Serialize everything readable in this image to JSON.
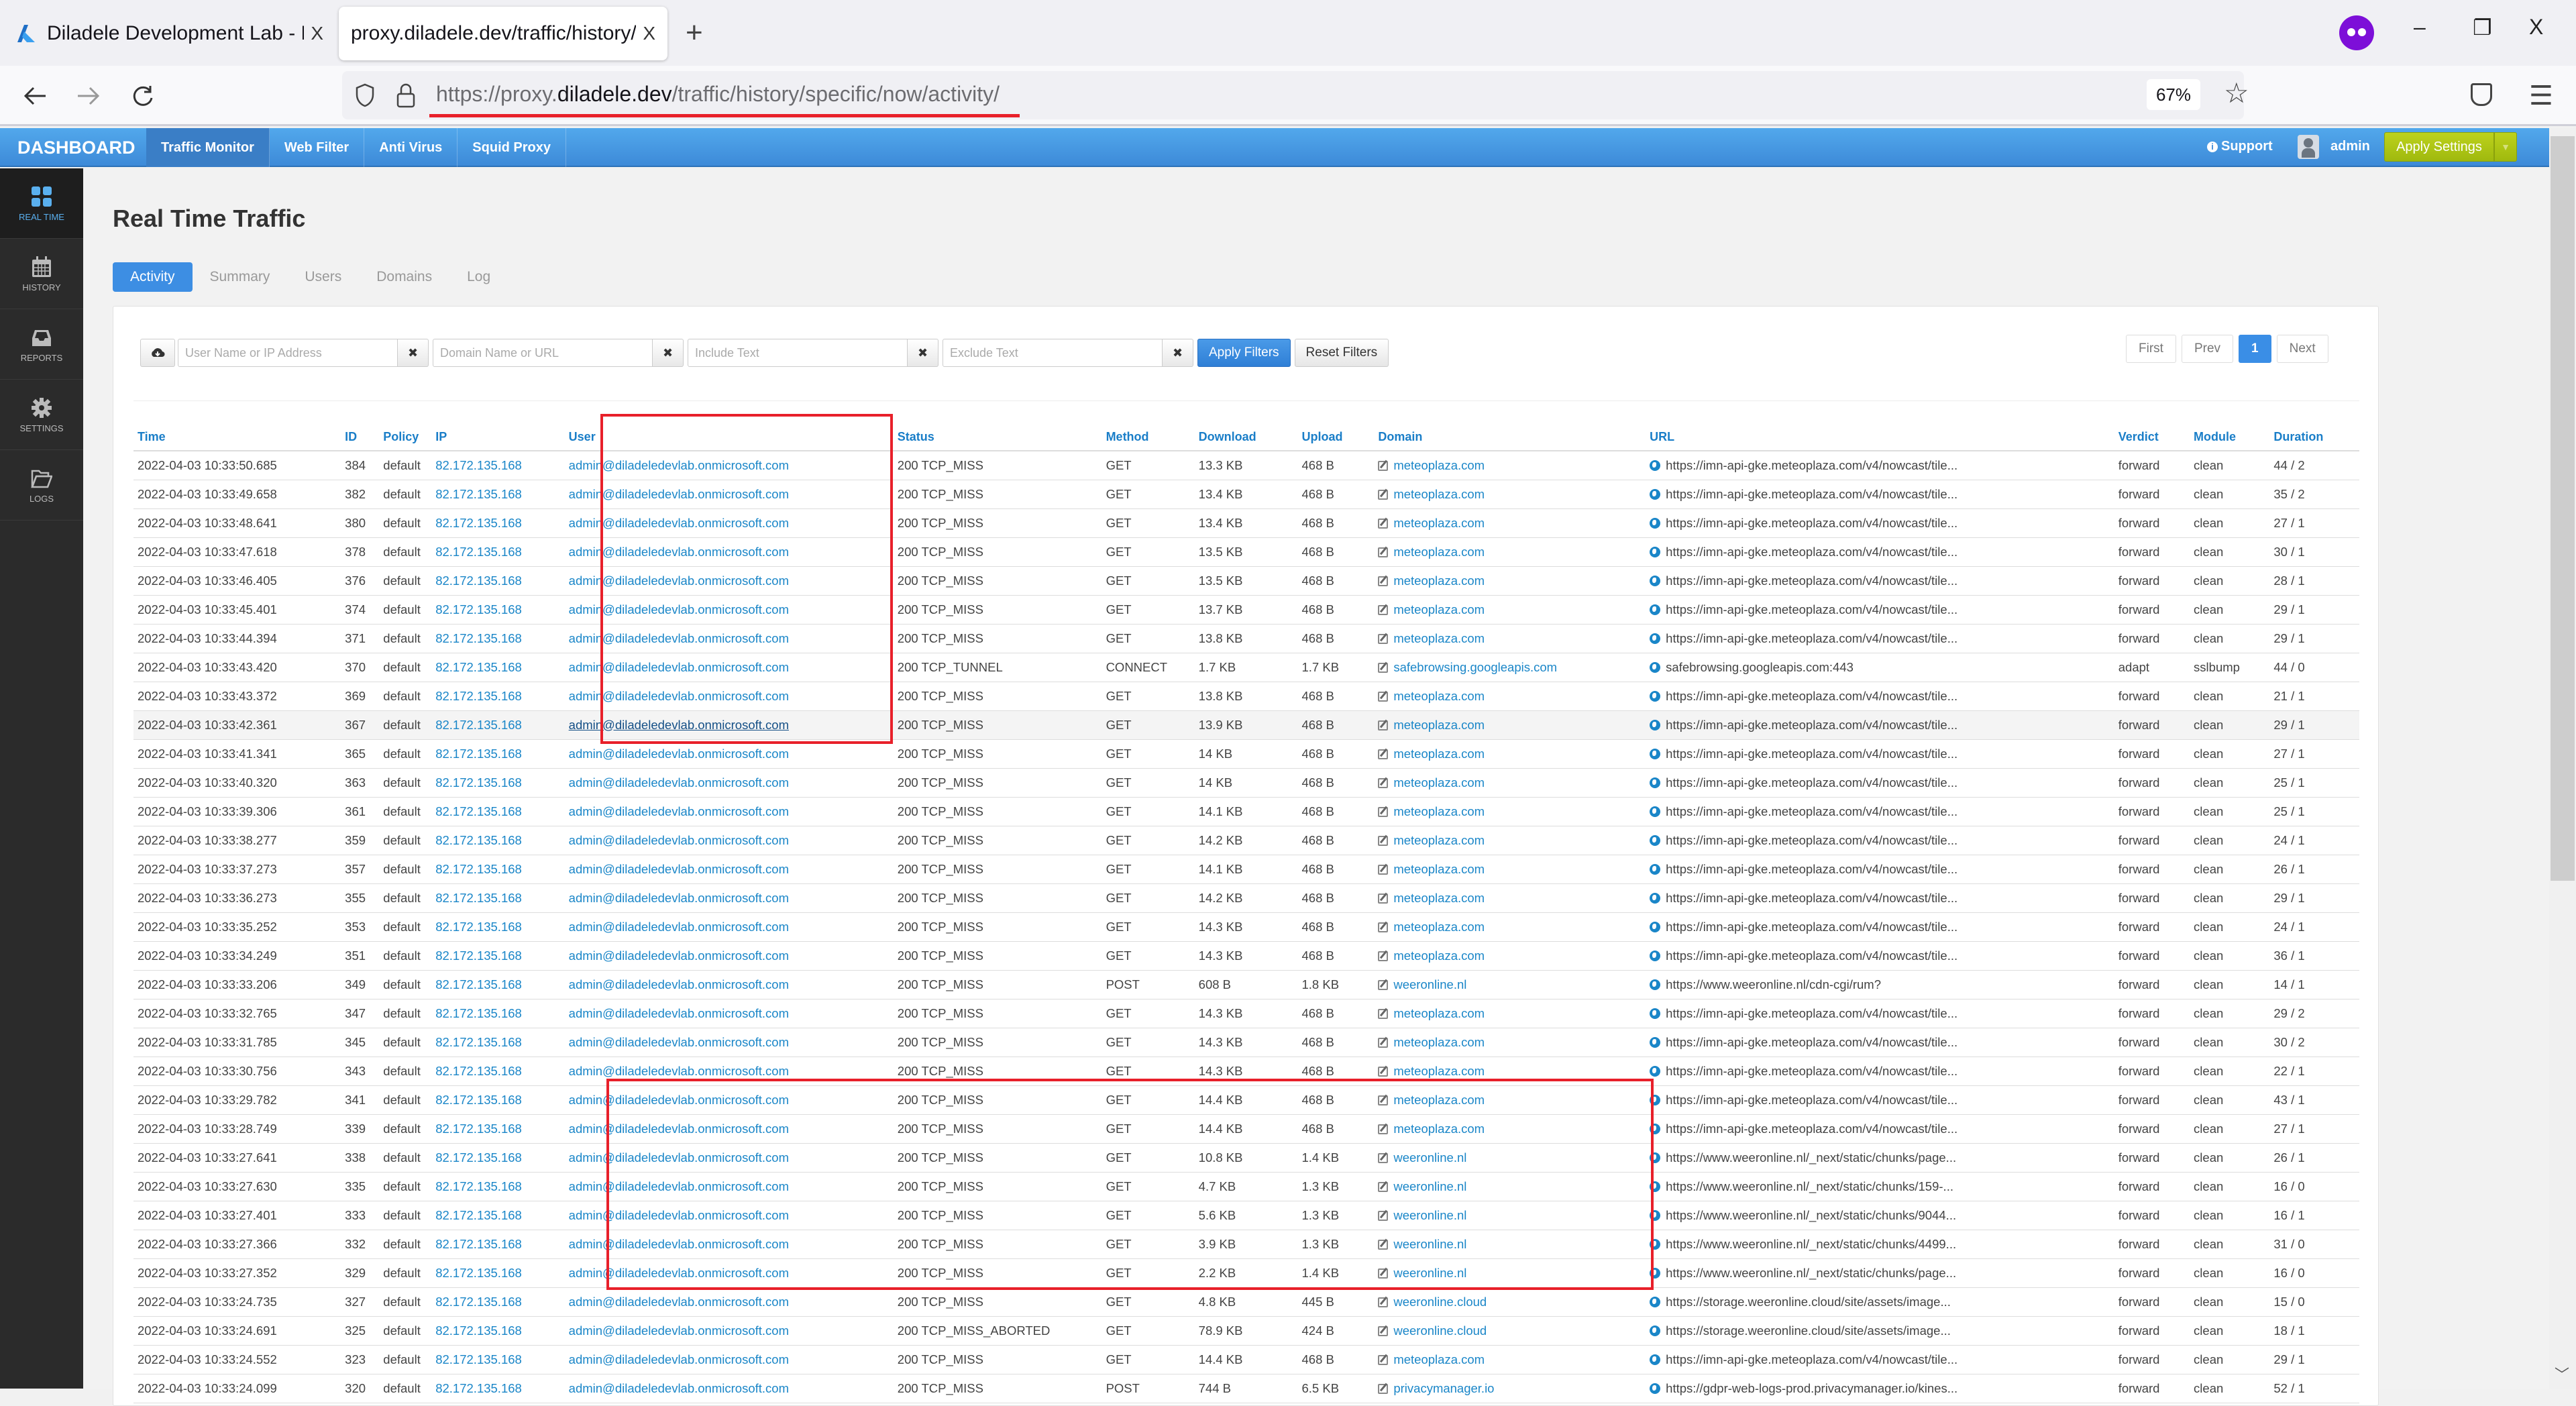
{
  "browser": {
    "tabs": [
      {
        "title": "Diladele Development Lab - Mic",
        "icon": "azure-logo-icon",
        "active": false
      },
      {
        "title": "proxy.diladele.dev/traffic/history/spe",
        "active": true
      }
    ],
    "close_glyph": "X",
    "new_tab_glyph": "+",
    "url_prefix": "https://proxy.",
    "url_domain": "diladele.dev",
    "url_path": "/traffic/history/specific/now/activity/",
    "zoom_level": "67%",
    "window_controls": {
      "minimize": "–",
      "restore": "❐",
      "close": "X"
    }
  },
  "app": {
    "brand": "DASHBOARD",
    "nav": [
      {
        "label": "Traffic Monitor",
        "active": true
      },
      {
        "label": "Web Filter",
        "active": false
      },
      {
        "label": "Anti Virus",
        "active": false
      },
      {
        "label": "Squid Proxy",
        "active": false
      }
    ],
    "support_label": "Support",
    "user_name": "admin",
    "apply_settings_label": "Apply Settings"
  },
  "sidebar": {
    "items": [
      {
        "label": "REAL TIME",
        "icon": "grid-icon",
        "active": true
      },
      {
        "label": "HISTORY",
        "icon": "calendar-icon",
        "active": false
      },
      {
        "label": "REPORTS",
        "icon": "inbox-icon",
        "active": false
      },
      {
        "label": "SETTINGS",
        "icon": "gear-icon",
        "active": false
      },
      {
        "label": "LOGS",
        "icon": "folder-icon",
        "active": false
      }
    ]
  },
  "page": {
    "title": "Real Time Traffic",
    "tabs": [
      {
        "label": "Activity",
        "active": true
      },
      {
        "label": "Summary",
        "active": false
      },
      {
        "label": "Users",
        "active": false
      },
      {
        "label": "Domains",
        "active": false
      },
      {
        "label": "Log",
        "active": false
      }
    ]
  },
  "filters": {
    "user_placeholder": "User Name or IP Address",
    "user_value": "",
    "domain_placeholder": "Domain Name or URL",
    "domain_value": "",
    "include_placeholder": "Include Text",
    "include_value": "",
    "exclude_placeholder": "Exclude Text",
    "exclude_value": "",
    "clear_glyph": "✖",
    "apply_label": "Apply Filters",
    "reset_label": "Reset Filters"
  },
  "pagination": {
    "first": "First",
    "prev": "Prev",
    "current": "1",
    "next": "Next"
  },
  "table": {
    "columns": [
      "Time",
      "ID",
      "Policy",
      "IP",
      "User",
      "Status",
      "Method",
      "Download",
      "Upload",
      "Domain",
      "URL",
      "Verdict",
      "Module",
      "Duration"
    ],
    "rows": [
      {
        "time": "2022-04-03 10:33:50.685",
        "id": "384",
        "policy": "default",
        "ip": "82.172.135.168",
        "user": "admin@diladeledevlab.onmicrosoft.com",
        "status": "200 TCP_MISS",
        "method": "GET",
        "download": "13.3 KB",
        "upload": "468 B",
        "domain": "meteoplaza.com",
        "url": "https://imn-api-gke.meteoplaza.com/v4/nowcast/tile...",
        "verdict": "forward",
        "module": "clean",
        "duration": "44 / 2"
      },
      {
        "time": "2022-04-03 10:33:49.658",
        "id": "382",
        "policy": "default",
        "ip": "82.172.135.168",
        "user": "admin@diladeledevlab.onmicrosoft.com",
        "status": "200 TCP_MISS",
        "method": "GET",
        "download": "13.4 KB",
        "upload": "468 B",
        "domain": "meteoplaza.com",
        "url": "https://imn-api-gke.meteoplaza.com/v4/nowcast/tile...",
        "verdict": "forward",
        "module": "clean",
        "duration": "35 / 2"
      },
      {
        "time": "2022-04-03 10:33:48.641",
        "id": "380",
        "policy": "default",
        "ip": "82.172.135.168",
        "user": "admin@diladeledevlab.onmicrosoft.com",
        "status": "200 TCP_MISS",
        "method": "GET",
        "download": "13.4 KB",
        "upload": "468 B",
        "domain": "meteoplaza.com",
        "url": "https://imn-api-gke.meteoplaza.com/v4/nowcast/tile...",
        "verdict": "forward",
        "module": "clean",
        "duration": "27 / 1"
      },
      {
        "time": "2022-04-03 10:33:47.618",
        "id": "378",
        "policy": "default",
        "ip": "82.172.135.168",
        "user": "admin@diladeledevlab.onmicrosoft.com",
        "status": "200 TCP_MISS",
        "method": "GET",
        "download": "13.5 KB",
        "upload": "468 B",
        "domain": "meteoplaza.com",
        "url": "https://imn-api-gke.meteoplaza.com/v4/nowcast/tile...",
        "verdict": "forward",
        "module": "clean",
        "duration": "30 / 1"
      },
      {
        "time": "2022-04-03 10:33:46.405",
        "id": "376",
        "policy": "default",
        "ip": "82.172.135.168",
        "user": "admin@diladeledevlab.onmicrosoft.com",
        "status": "200 TCP_MISS",
        "method": "GET",
        "download": "13.5 KB",
        "upload": "468 B",
        "domain": "meteoplaza.com",
        "url": "https://imn-api-gke.meteoplaza.com/v4/nowcast/tile...",
        "verdict": "forward",
        "module": "clean",
        "duration": "28 / 1"
      },
      {
        "time": "2022-04-03 10:33:45.401",
        "id": "374",
        "policy": "default",
        "ip": "82.172.135.168",
        "user": "admin@diladeledevlab.onmicrosoft.com",
        "status": "200 TCP_MISS",
        "method": "GET",
        "download": "13.7 KB",
        "upload": "468 B",
        "domain": "meteoplaza.com",
        "url": "https://imn-api-gke.meteoplaza.com/v4/nowcast/tile...",
        "verdict": "forward",
        "module": "clean",
        "duration": "29 / 1"
      },
      {
        "time": "2022-04-03 10:33:44.394",
        "id": "371",
        "policy": "default",
        "ip": "82.172.135.168",
        "user": "admin@diladeledevlab.onmicrosoft.com",
        "status": "200 TCP_MISS",
        "method": "GET",
        "download": "13.8 KB",
        "upload": "468 B",
        "domain": "meteoplaza.com",
        "url": "https://imn-api-gke.meteoplaza.com/v4/nowcast/tile...",
        "verdict": "forward",
        "module": "clean",
        "duration": "29 / 1"
      },
      {
        "time": "2022-04-03 10:33:43.420",
        "id": "370",
        "policy": "default",
        "ip": "82.172.135.168",
        "user": "admin@diladeledevlab.onmicrosoft.com",
        "status": "200 TCP_TUNNEL",
        "method": "CONNECT",
        "download": "1.7 KB",
        "upload": "1.7 KB",
        "domain": "safebrowsing.googleapis.com",
        "url": "safebrowsing.googleapis.com:443",
        "verdict": "adapt",
        "module": "sslbump",
        "duration": "44 / 0"
      },
      {
        "time": "2022-04-03 10:33:43.372",
        "id": "369",
        "policy": "default",
        "ip": "82.172.135.168",
        "user": "admin@diladeledevlab.onmicrosoft.com",
        "status": "200 TCP_MISS",
        "method": "GET",
        "download": "13.8 KB",
        "upload": "468 B",
        "domain": "meteoplaza.com",
        "url": "https://imn-api-gke.meteoplaza.com/v4/nowcast/tile...",
        "verdict": "forward",
        "module": "clean",
        "duration": "21 / 1"
      },
      {
        "time": "2022-04-03 10:33:42.361",
        "id": "367",
        "policy": "default",
        "ip": "82.172.135.168",
        "user": "admin@diladeledevlab.onmicrosoft.com",
        "status": "200 TCP_MISS",
        "method": "GET",
        "download": "13.9 KB",
        "upload": "468 B",
        "domain": "meteoplaza.com",
        "url": "https://imn-api-gke.meteoplaza.com/v4/nowcast/tile...",
        "verdict": "forward",
        "module": "clean",
        "duration": "29 / 1",
        "hovered": true
      },
      {
        "time": "2022-04-03 10:33:41.341",
        "id": "365",
        "policy": "default",
        "ip": "82.172.135.168",
        "user": "admin@diladeledevlab.onmicrosoft.com",
        "status": "200 TCP_MISS",
        "method": "GET",
        "download": "14 KB",
        "upload": "468 B",
        "domain": "meteoplaza.com",
        "url": "https://imn-api-gke.meteoplaza.com/v4/nowcast/tile...",
        "verdict": "forward",
        "module": "clean",
        "duration": "27 / 1"
      },
      {
        "time": "2022-04-03 10:33:40.320",
        "id": "363",
        "policy": "default",
        "ip": "82.172.135.168",
        "user": "admin@diladeledevlab.onmicrosoft.com",
        "status": "200 TCP_MISS",
        "method": "GET",
        "download": "14 KB",
        "upload": "468 B",
        "domain": "meteoplaza.com",
        "url": "https://imn-api-gke.meteoplaza.com/v4/nowcast/tile...",
        "verdict": "forward",
        "module": "clean",
        "duration": "25 / 1"
      },
      {
        "time": "2022-04-03 10:33:39.306",
        "id": "361",
        "policy": "default",
        "ip": "82.172.135.168",
        "user": "admin@diladeledevlab.onmicrosoft.com",
        "status": "200 TCP_MISS",
        "method": "GET",
        "download": "14.1 KB",
        "upload": "468 B",
        "domain": "meteoplaza.com",
        "url": "https://imn-api-gke.meteoplaza.com/v4/nowcast/tile...",
        "verdict": "forward",
        "module": "clean",
        "duration": "25 / 1"
      },
      {
        "time": "2022-04-03 10:33:38.277",
        "id": "359",
        "policy": "default",
        "ip": "82.172.135.168",
        "user": "admin@diladeledevlab.onmicrosoft.com",
        "status": "200 TCP_MISS",
        "method": "GET",
        "download": "14.2 KB",
        "upload": "468 B",
        "domain": "meteoplaza.com",
        "url": "https://imn-api-gke.meteoplaza.com/v4/nowcast/tile...",
        "verdict": "forward",
        "module": "clean",
        "duration": "24 / 1"
      },
      {
        "time": "2022-04-03 10:33:37.273",
        "id": "357",
        "policy": "default",
        "ip": "82.172.135.168",
        "user": "admin@diladeledevlab.onmicrosoft.com",
        "status": "200 TCP_MISS",
        "method": "GET",
        "download": "14.1 KB",
        "upload": "468 B",
        "domain": "meteoplaza.com",
        "url": "https://imn-api-gke.meteoplaza.com/v4/nowcast/tile...",
        "verdict": "forward",
        "module": "clean",
        "duration": "26 / 1"
      },
      {
        "time": "2022-04-03 10:33:36.273",
        "id": "355",
        "policy": "default",
        "ip": "82.172.135.168",
        "user": "admin@diladeledevlab.onmicrosoft.com",
        "status": "200 TCP_MISS",
        "method": "GET",
        "download": "14.2 KB",
        "upload": "468 B",
        "domain": "meteoplaza.com",
        "url": "https://imn-api-gke.meteoplaza.com/v4/nowcast/tile...",
        "verdict": "forward",
        "module": "clean",
        "duration": "29 / 1"
      },
      {
        "time": "2022-04-03 10:33:35.252",
        "id": "353",
        "policy": "default",
        "ip": "82.172.135.168",
        "user": "admin@diladeledevlab.onmicrosoft.com",
        "status": "200 TCP_MISS",
        "method": "GET",
        "download": "14.3 KB",
        "upload": "468 B",
        "domain": "meteoplaza.com",
        "url": "https://imn-api-gke.meteoplaza.com/v4/nowcast/tile...",
        "verdict": "forward",
        "module": "clean",
        "duration": "24 / 1"
      },
      {
        "time": "2022-04-03 10:33:34.249",
        "id": "351",
        "policy": "default",
        "ip": "82.172.135.168",
        "user": "admin@diladeledevlab.onmicrosoft.com",
        "status": "200 TCP_MISS",
        "method": "GET",
        "download": "14.3 KB",
        "upload": "468 B",
        "domain": "meteoplaza.com",
        "url": "https://imn-api-gke.meteoplaza.com/v4/nowcast/tile...",
        "verdict": "forward",
        "module": "clean",
        "duration": "36 / 1"
      },
      {
        "time": "2022-04-03 10:33:33.206",
        "id": "349",
        "policy": "default",
        "ip": "82.172.135.168",
        "user": "admin@diladeledevlab.onmicrosoft.com",
        "status": "200 TCP_MISS",
        "method": "POST",
        "download": "608 B",
        "upload": "1.8 KB",
        "domain": "weeronline.nl",
        "url": "https://www.weeronline.nl/cdn-cgi/rum?",
        "verdict": "forward",
        "module": "clean",
        "duration": "14 / 1"
      },
      {
        "time": "2022-04-03 10:33:32.765",
        "id": "347",
        "policy": "default",
        "ip": "82.172.135.168",
        "user": "admin@diladeledevlab.onmicrosoft.com",
        "status": "200 TCP_MISS",
        "method": "GET",
        "download": "14.3 KB",
        "upload": "468 B",
        "domain": "meteoplaza.com",
        "url": "https://imn-api-gke.meteoplaza.com/v4/nowcast/tile...",
        "verdict": "forward",
        "module": "clean",
        "duration": "29 / 2"
      },
      {
        "time": "2022-04-03 10:33:31.785",
        "id": "345",
        "policy": "default",
        "ip": "82.172.135.168",
        "user": "admin@diladeledevlab.onmicrosoft.com",
        "status": "200 TCP_MISS",
        "method": "GET",
        "download": "14.3 KB",
        "upload": "468 B",
        "domain": "meteoplaza.com",
        "url": "https://imn-api-gke.meteoplaza.com/v4/nowcast/tile...",
        "verdict": "forward",
        "module": "clean",
        "duration": "30 / 2"
      },
      {
        "time": "2022-04-03 10:33:30.756",
        "id": "343",
        "policy": "default",
        "ip": "82.172.135.168",
        "user": "admin@diladeledevlab.onmicrosoft.com",
        "status": "200 TCP_MISS",
        "method": "GET",
        "download": "14.3 KB",
        "upload": "468 B",
        "domain": "meteoplaza.com",
        "url": "https://imn-api-gke.meteoplaza.com/v4/nowcast/tile...",
        "verdict": "forward",
        "module": "clean",
        "duration": "22 / 1"
      },
      {
        "time": "2022-04-03 10:33:29.782",
        "id": "341",
        "policy": "default",
        "ip": "82.172.135.168",
        "user": "admin@diladeledevlab.onmicrosoft.com",
        "status": "200 TCP_MISS",
        "method": "GET",
        "download": "14.4 KB",
        "upload": "468 B",
        "domain": "meteoplaza.com",
        "url": "https://imn-api-gke.meteoplaza.com/v4/nowcast/tile...",
        "verdict": "forward",
        "module": "clean",
        "duration": "43 / 1"
      },
      {
        "time": "2022-04-03 10:33:28.749",
        "id": "339",
        "policy": "default",
        "ip": "82.172.135.168",
        "user": "admin@diladeledevlab.onmicrosoft.com",
        "status": "200 TCP_MISS",
        "method": "GET",
        "download": "14.4 KB",
        "upload": "468 B",
        "domain": "meteoplaza.com",
        "url": "https://imn-api-gke.meteoplaza.com/v4/nowcast/tile...",
        "verdict": "forward",
        "module": "clean",
        "duration": "27 / 1"
      },
      {
        "time": "2022-04-03 10:33:27.641",
        "id": "338",
        "policy": "default",
        "ip": "82.172.135.168",
        "user": "admin@diladeledevlab.onmicrosoft.com",
        "status": "200 TCP_MISS",
        "method": "GET",
        "download": "10.8 KB",
        "upload": "1.4 KB",
        "domain": "weeronline.nl",
        "url": "https://www.weeronline.nl/_next/static/chunks/page...",
        "verdict": "forward",
        "module": "clean",
        "duration": "26 / 1"
      },
      {
        "time": "2022-04-03 10:33:27.630",
        "id": "335",
        "policy": "default",
        "ip": "82.172.135.168",
        "user": "admin@diladeledevlab.onmicrosoft.com",
        "status": "200 TCP_MISS",
        "method": "GET",
        "download": "4.7 KB",
        "upload": "1.3 KB",
        "domain": "weeronline.nl",
        "url": "https://www.weeronline.nl/_next/static/chunks/159-...",
        "verdict": "forward",
        "module": "clean",
        "duration": "16 / 0"
      },
      {
        "time": "2022-04-03 10:33:27.401",
        "id": "333",
        "policy": "default",
        "ip": "82.172.135.168",
        "user": "admin@diladeledevlab.onmicrosoft.com",
        "status": "200 TCP_MISS",
        "method": "GET",
        "download": "5.6 KB",
        "upload": "1.3 KB",
        "domain": "weeronline.nl",
        "url": "https://www.weeronline.nl/_next/static/chunks/9044...",
        "verdict": "forward",
        "module": "clean",
        "duration": "16 / 1"
      },
      {
        "time": "2022-04-03 10:33:27.366",
        "id": "332",
        "policy": "default",
        "ip": "82.172.135.168",
        "user": "admin@diladeledevlab.onmicrosoft.com",
        "status": "200 TCP_MISS",
        "method": "GET",
        "download": "3.9 KB",
        "upload": "1.3 KB",
        "domain": "weeronline.nl",
        "url": "https://www.weeronline.nl/_next/static/chunks/4499...",
        "verdict": "forward",
        "module": "clean",
        "duration": "31 / 0"
      },
      {
        "time": "2022-04-03 10:33:27.352",
        "id": "329",
        "policy": "default",
        "ip": "82.172.135.168",
        "user": "admin@diladeledevlab.onmicrosoft.com",
        "status": "200 TCP_MISS",
        "method": "GET",
        "download": "2.2 KB",
        "upload": "1.4 KB",
        "domain": "weeronline.nl",
        "url": "https://www.weeronline.nl/_next/static/chunks/page...",
        "verdict": "forward",
        "module": "clean",
        "duration": "16 / 0"
      },
      {
        "time": "2022-04-03 10:33:24.735",
        "id": "327",
        "policy": "default",
        "ip": "82.172.135.168",
        "user": "admin@diladeledevlab.onmicrosoft.com",
        "status": "200 TCP_MISS",
        "method": "GET",
        "download": "4.8 KB",
        "upload": "445 B",
        "domain": "weeronline.cloud",
        "url": "https://storage.weeronline.cloud/site/assets/image...",
        "verdict": "forward",
        "module": "clean",
        "duration": "15 / 0"
      },
      {
        "time": "2022-04-03 10:33:24.691",
        "id": "325",
        "policy": "default",
        "ip": "82.172.135.168",
        "user": "admin@diladeledevlab.onmicrosoft.com",
        "status": "200 TCP_MISS_ABORTED",
        "method": "GET",
        "download": "78.9 KB",
        "upload": "424 B",
        "domain": "weeronline.cloud",
        "url": "https://storage.weeronline.cloud/site/assets/image...",
        "verdict": "forward",
        "module": "clean",
        "duration": "18 / 1"
      },
      {
        "time": "2022-04-03 10:33:24.552",
        "id": "323",
        "policy": "default",
        "ip": "82.172.135.168",
        "user": "admin@diladeledevlab.onmicrosoft.com",
        "status": "200 TCP_MISS",
        "method": "GET",
        "download": "14.4 KB",
        "upload": "468 B",
        "domain": "meteoplaza.com",
        "url": "https://imn-api-gke.meteoplaza.com/v4/nowcast/tile...",
        "verdict": "forward",
        "module": "clean",
        "duration": "29 / 1"
      },
      {
        "time": "2022-04-03 10:33:24.099",
        "id": "320",
        "policy": "default",
        "ip": "82.172.135.168",
        "user": "admin@diladeledevlab.onmicrosoft.com",
        "status": "200 TCP_MISS",
        "method": "POST",
        "download": "744 B",
        "upload": "6.5 KB",
        "domain": "privacymanager.io",
        "url": "https://gdpr-web-logs-prod.privacymanager.io/kines...",
        "verdict": "forward",
        "module": "clean",
        "duration": "52 / 1"
      }
    ]
  },
  "colors": {
    "accent_blue": "#3d8ee3",
    "link_blue": "#1a86c8",
    "apply_settings_green": "#aec614",
    "annotation_red": "#e8202a",
    "sidebar_bg": "#2b2b2b"
  }
}
